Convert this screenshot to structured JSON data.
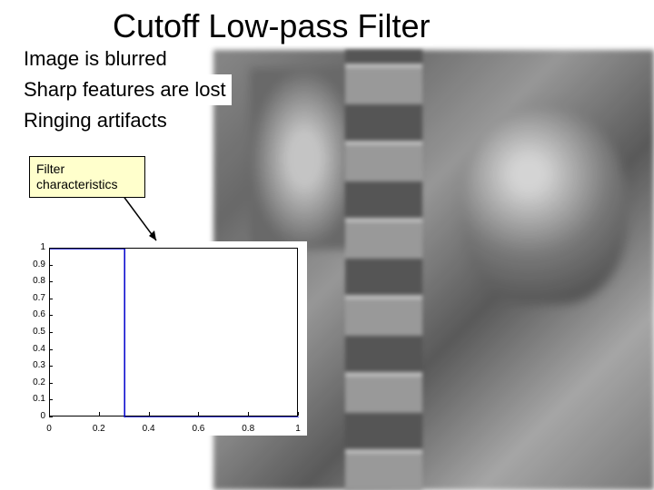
{
  "title": "Cutoff Low-pass Filter",
  "bullets": {
    "b1": "Image is blurred",
    "b2": "Sharp features are lost",
    "b3": "Ringing artifacts"
  },
  "callout": {
    "label": "Filter characteristics"
  },
  "chart_data": {
    "type": "line",
    "x": [
      0,
      0.3,
      0.3,
      1.0
    ],
    "y": [
      1,
      1,
      0,
      0
    ],
    "xlim": [
      0,
      1
    ],
    "ylim": [
      0,
      1
    ],
    "xticks": [
      0,
      0.2,
      0.4,
      0.6,
      0.8,
      1
    ],
    "yticks": [
      0,
      0.1,
      0.2,
      0.3,
      0.4,
      0.5,
      0.6,
      0.7,
      0.8,
      0.9,
      1
    ],
    "xtick_labels": [
      "0",
      "0.2",
      "0.4",
      "0.6",
      "0.8",
      "1"
    ],
    "ytick_labels": [
      "0",
      "0.1",
      "0.2",
      "0.3",
      "0.4",
      "0.5",
      "0.6",
      "0.7",
      "0.8",
      "0.9",
      "1"
    ],
    "title": "",
    "xlabel": "",
    "ylabel": ""
  }
}
